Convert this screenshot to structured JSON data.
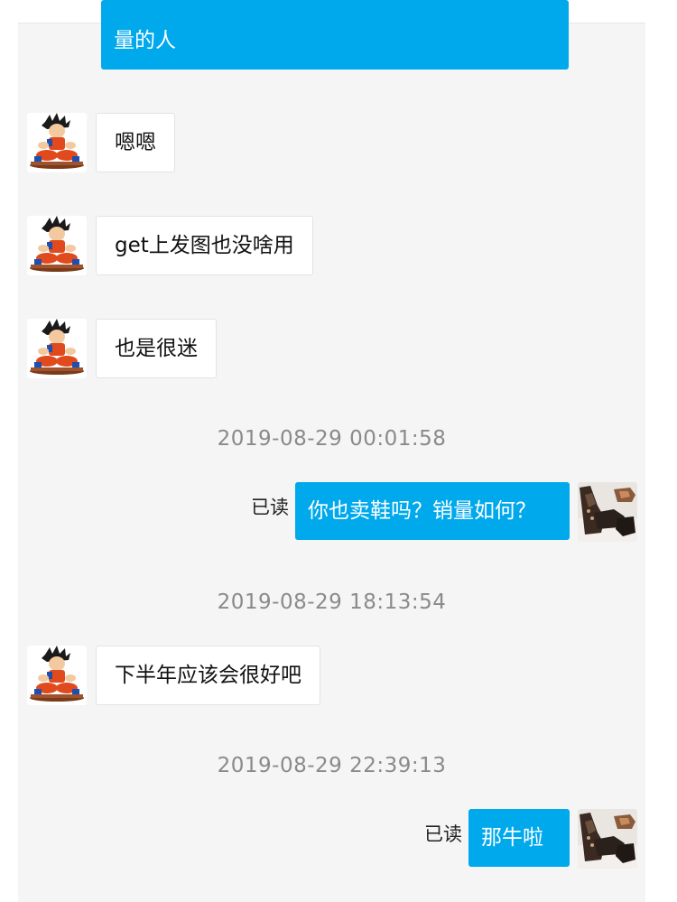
{
  "header": {
    "title": ""
  },
  "messages": [
    {
      "id": "m0",
      "text": "量的人"
    },
    {
      "id": "m1",
      "text": "嗯嗯"
    },
    {
      "id": "m2",
      "text": "get上发图也没啥用"
    },
    {
      "id": "m3",
      "text": "也是很迷"
    },
    {
      "id": "m4",
      "text": "你也卖鞋吗？销量如何？",
      "status": "已读"
    },
    {
      "id": "m5",
      "text": "下半年应该会很好吧"
    },
    {
      "id": "m6",
      "text": "那牛啦",
      "status": "已读"
    }
  ],
  "timestamps": [
    "2019-08-29 00:01:58",
    "2019-08-29 18:13:54",
    "2019-08-29 22:39:13"
  ],
  "colors": {
    "outgoing_bubble": "#00a8ec",
    "incoming_bubble": "#ffffff",
    "chat_background": "#f5f5f5",
    "timestamp_text": "#8a8a8a"
  },
  "icons": {
    "contact_avatar": "cartoon-boy-avatar-icon",
    "self_avatar": "shoes-photo-avatar-icon"
  }
}
